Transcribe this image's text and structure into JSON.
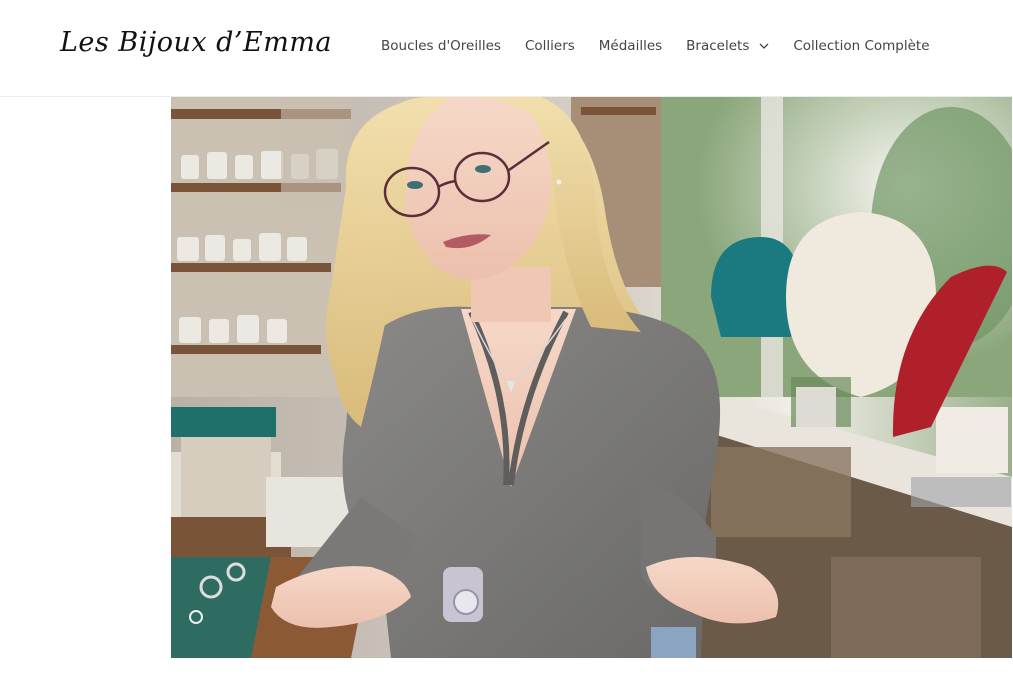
{
  "header": {
    "logo_text": "Les Bijoux d’Emma",
    "nav": [
      {
        "label": "Boucles d'Oreilles"
      },
      {
        "label": "Colliers"
      },
      {
        "label": "Médailles"
      },
      {
        "label": "Bracelets",
        "has_dropdown": true,
        "icon": "chevron-down-icon"
      },
      {
        "label": "Collection Complète"
      }
    ]
  },
  "hero": {
    "image": "woman-with-glasses-at-jewelry-workshop-counter"
  },
  "colors": {
    "background": "#ffffff",
    "nav_text": "#444444",
    "logo_text": "#111111",
    "sweater": "#7d7c7a",
    "hair": "#ead39a",
    "teal_display": "#1b7a7f",
    "red_display": "#b0202a"
  }
}
